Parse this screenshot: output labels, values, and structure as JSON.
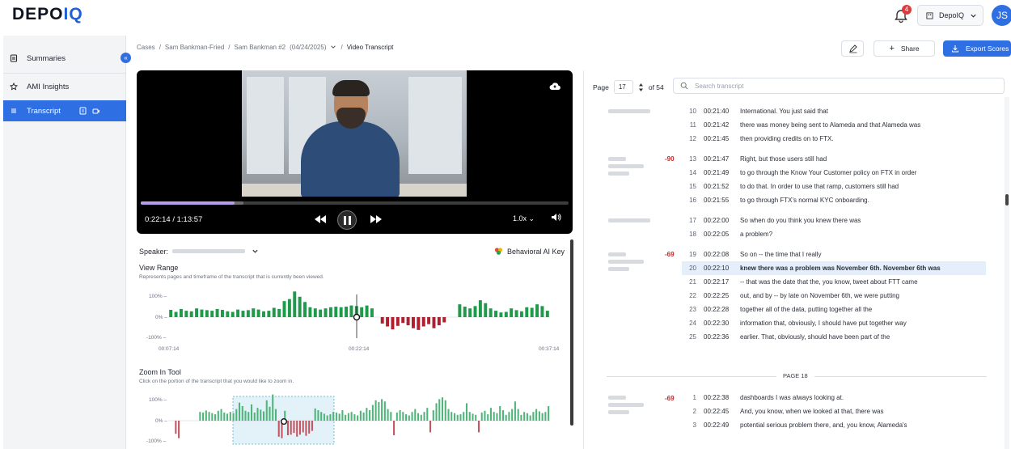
{
  "brand": {
    "logo_main": "DEPO",
    "logo_iq": "IQ"
  },
  "header": {
    "notifications_count": "4",
    "org_select_label": "DepoIQ",
    "avatar_initials": "JS"
  },
  "sidebar": {
    "items": [
      {
        "label": "Summaries",
        "icon": "document-icon"
      },
      {
        "label": "AMI Insights",
        "icon": "star-icon"
      },
      {
        "label": "Transcript",
        "icon": "list-icon",
        "active": true
      }
    ]
  },
  "breadcrumb": {
    "items": [
      "Cases",
      "Sam Bankman-Fried",
      "Sam Bankman #2",
      "(04/24/2025)",
      "Video Transcript"
    ]
  },
  "toolbar": {
    "share_label": "Share",
    "export_label": "Export Scores"
  },
  "video": {
    "time_label": "0:22:14 / 1:13:57",
    "speed_label": "1.0x",
    "progress_played": 0.22,
    "progress_buffered": 0.24
  },
  "analytics": {
    "speaker_label": "Speaker:",
    "ai_key_label": "Behavioral AI Key",
    "view_range": {
      "title": "View Range",
      "subtitle": "Represents pages and timeframe of the transcript that is currently been viewed.",
      "y_ticks": [
        "100% –",
        "0% –",
        "-100% –"
      ],
      "x_ticks": [
        "00:07:14",
        "00:22:14",
        "00:37:14"
      ]
    },
    "zoom_tool": {
      "title": "Zoom In Tool",
      "subtitle": "Click on the portion of the transcript that you would like to zoom in.",
      "y_ticks": [
        "100% –",
        "0% –",
        "-100% –"
      ]
    }
  },
  "chart_data": [
    {
      "type": "bar",
      "title": "View Range",
      "x_ticks": [
        "00:07:14",
        "00:22:14",
        "00:37:14"
      ],
      "ylim": [
        -100,
        100
      ],
      "values": [
        25,
        18,
        28,
        22,
        20,
        30,
        26,
        24,
        22,
        28,
        25,
        20,
        18,
        26,
        22,
        24,
        30,
        26,
        20,
        22,
        32,
        28,
        55,
        62,
        88,
        70,
        52,
        34,
        30,
        26,
        30,
        34,
        36,
        34,
        36,
        40,
        38,
        34,
        40,
        30,
        0,
        -22,
        -32,
        -42,
        -30,
        -20,
        -28,
        -38,
        -44,
        -32,
        -24,
        -38,
        -28,
        -18,
        0,
        0,
        44,
        36,
        30,
        38,
        58,
        48,
        30,
        22,
        16,
        18,
        30,
        24,
        20,
        34,
        32,
        44,
        38,
        22
      ]
    },
    {
      "type": "bar",
      "title": "Zoom In Tool",
      "ylim": [
        -100,
        100
      ],
      "values": [
        0,
        0,
        -45,
        -60,
        0,
        0,
        0,
        0,
        0,
        0,
        30,
        28,
        35,
        30,
        26,
        22,
        34,
        40,
        28,
        24,
        30,
        26,
        40,
        62,
        50,
        34,
        30,
        56,
        28,
        44,
        38,
        32,
        70,
        48,
        90,
        40,
        -55,
        -60,
        34,
        -50,
        -48,
        -42,
        -55,
        -48,
        -40,
        -52,
        -44,
        -35,
        42,
        36,
        30,
        24,
        18,
        22,
        30,
        28,
        24,
        36,
        20,
        26,
        30,
        22,
        18,
        34,
        28,
        44,
        36,
        54,
        70,
        64,
        74,
        66,
        40,
        30,
        -50,
        28,
        36,
        30,
        22,
        18,
        30,
        40,
        26,
        20,
        30,
        44,
        -40,
        36,
        60,
        74,
        80,
        70,
        40,
        30,
        26,
        20,
        22,
        30,
        60,
        30,
        24,
        20,
        -40,
        28,
        34,
        22,
        44,
        30,
        26,
        50,
        36,
        20,
        30,
        40,
        66,
        40,
        20,
        30,
        26,
        18,
        30,
        40,
        32,
        26,
        30,
        50
      ]
    }
  ],
  "transcript": {
    "page_label": "Page",
    "page_value": "17",
    "page_total": "of 54",
    "search_placeholder": "Search transcript",
    "rows": [
      {
        "line": "10",
        "time": "00:21:40",
        "text": "International. You just said that"
      },
      {
        "line": "11",
        "time": "00:21:42",
        "text": "there was money being sent to Alameda and that Alameda was"
      },
      {
        "line": "12",
        "time": "00:21:45",
        "text": "then providing credits on to FTX."
      },
      {
        "line": "13",
        "time": "00:21:47",
        "text": "Right, but those users still had"
      },
      {
        "line": "14",
        "time": "00:21:49",
        "text": "to go through the Know Your Customer policy on FTX in order"
      },
      {
        "line": "15",
        "time": "00:21:52",
        "text": "to do that. In order to use that ramp, customers still had"
      },
      {
        "line": "16",
        "time": "00:21:55",
        "text": "to go through FTX's normal KYC onboarding."
      },
      {
        "line": "17",
        "time": "00:22:00",
        "text": "So when do you think you knew there was"
      },
      {
        "line": "18",
        "time": "00:22:05",
        "text": "a problem?"
      },
      {
        "line": "19",
        "time": "00:22:08",
        "text": "So on -- the time that I really"
      },
      {
        "line": "20",
        "time": "00:22:10",
        "text": "knew there was a problem was November 6th. November 6th was",
        "highlight": true
      },
      {
        "line": "21",
        "time": "00:22:17",
        "text": "-- that was the date that the, you know, tweet about FTT came"
      },
      {
        "line": "22",
        "time": "00:22:25",
        "text": "out, and by -- by late on November 6th, we were putting"
      },
      {
        "line": "23",
        "time": "00:22:28",
        "text": "together all of the data, putting together all the"
      },
      {
        "line": "24",
        "time": "00:22:30",
        "text": "information that, obviously, I should have put together way"
      },
      {
        "line": "25",
        "time": "00:22:36",
        "text": "earlier. That, obviously, should have been part of the"
      }
    ],
    "scores": [
      "-90",
      "-69"
    ],
    "page_separator": "PAGE 18",
    "next_rows": [
      {
        "line": "1",
        "time": "00:22:38",
        "text": "dashboards I was always looking at."
      },
      {
        "line": "2",
        "time": "00:22:45",
        "text": "And, you know, when we looked at that, there was"
      },
      {
        "line": "3",
        "time": "00:22:49",
        "text": "potential serious problem there, and, you know, Alameda's"
      }
    ],
    "next_score": "-69"
  },
  "colors": {
    "accent": "#2f6fe4",
    "positive": "#1f9a4b",
    "negative": "#b01f2e",
    "zoom_positive": "#4fb47a",
    "zoom_negative": "#c25560",
    "score_red": "#c02a2a"
  }
}
